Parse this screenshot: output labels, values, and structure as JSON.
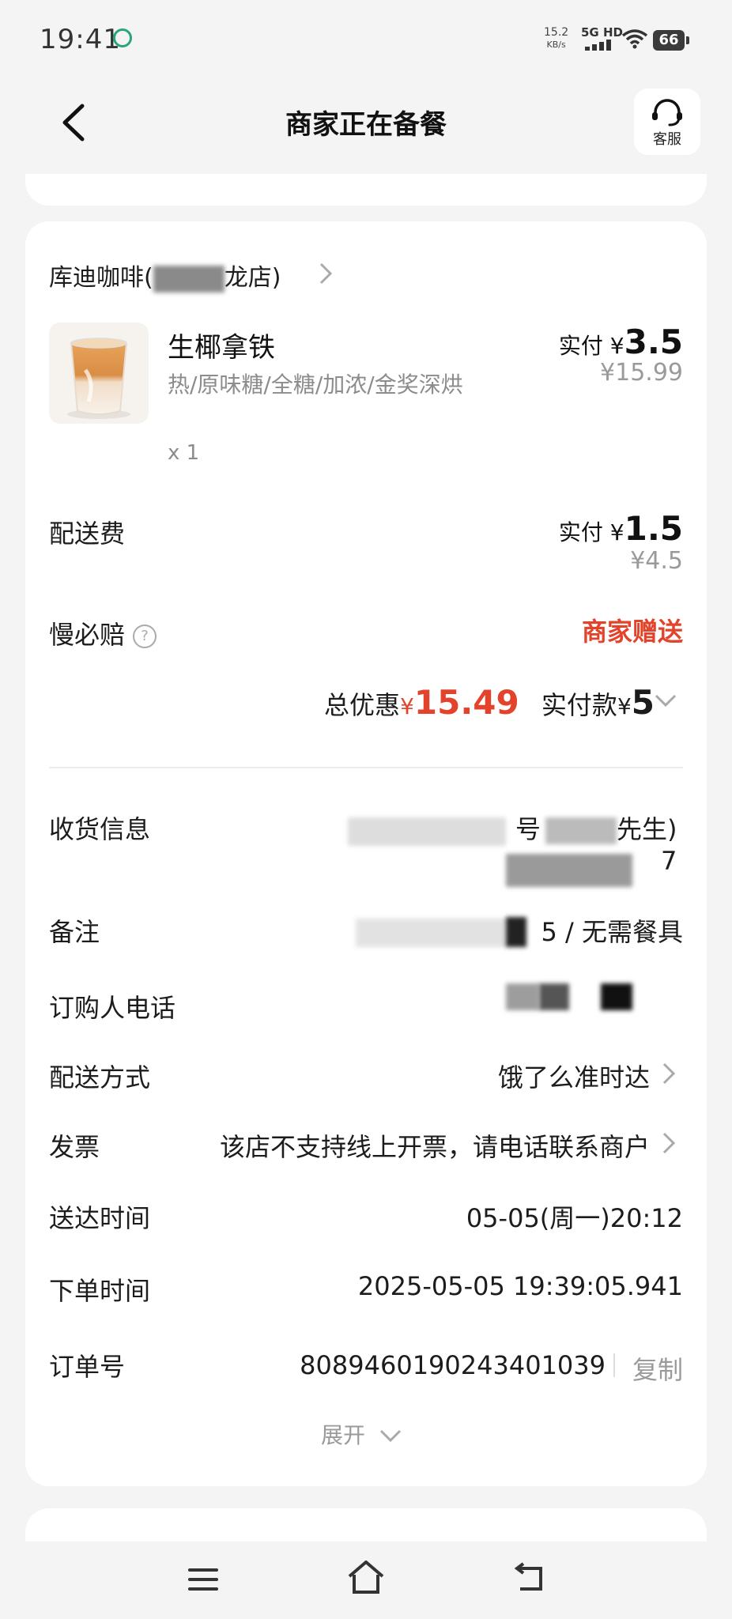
{
  "status_bar": {
    "time": "19:41",
    "net_speed_value": "15.2",
    "net_speed_unit": "KB/s",
    "network": "5G HD",
    "battery": "66"
  },
  "header": {
    "title": "商家正在备餐",
    "customer_service_label": "客服"
  },
  "store": {
    "name_prefix": "库迪咖啡(",
    "name_suffix": "龙店)"
  },
  "product": {
    "name": "生椰拿铁",
    "spec": "热/原味糖/全糖/加浓/金奖深烘",
    "qty": "x 1",
    "paid_label": "实付 ¥",
    "paid_amount": "3.5",
    "original_price": "¥15.99"
  },
  "delivery_fee": {
    "label": "配送费",
    "paid_label": "实付 ¥",
    "paid_amount": "1.5",
    "original_price": "¥4.5"
  },
  "slow_compensation": {
    "label": "慢必赔",
    "value": "商家赠送"
  },
  "totals": {
    "discount_label": "总优惠",
    "discount_currency": "¥",
    "discount_amount": "15.49",
    "actual_label": "实付款",
    "actual_currency": "¥",
    "actual_amount": "5"
  },
  "info": {
    "receiver_label": "收货信息",
    "receiver_value_line1": "号",
    "receiver_value_end": "先生)",
    "receiver_value_line2": "7",
    "remark_label": "备注",
    "remark_value": "5 / 无需餐具",
    "phone_label": "订购人电话",
    "delivery_method_label": "配送方式",
    "delivery_method_value": "饿了么准时达",
    "invoice_label": "发票",
    "invoice_value": "该店不支持线上开票，请电话联系商户",
    "arrival_label": "送达时间",
    "arrival_value": "05-05(周一)20:12",
    "order_time_label": "下单时间",
    "order_time_value": "2025-05-05 19:39:05.941",
    "order_no_label": "订单号",
    "order_no_value": "8089460190243401039",
    "copy_label": "复制",
    "expand_label": "展开"
  }
}
